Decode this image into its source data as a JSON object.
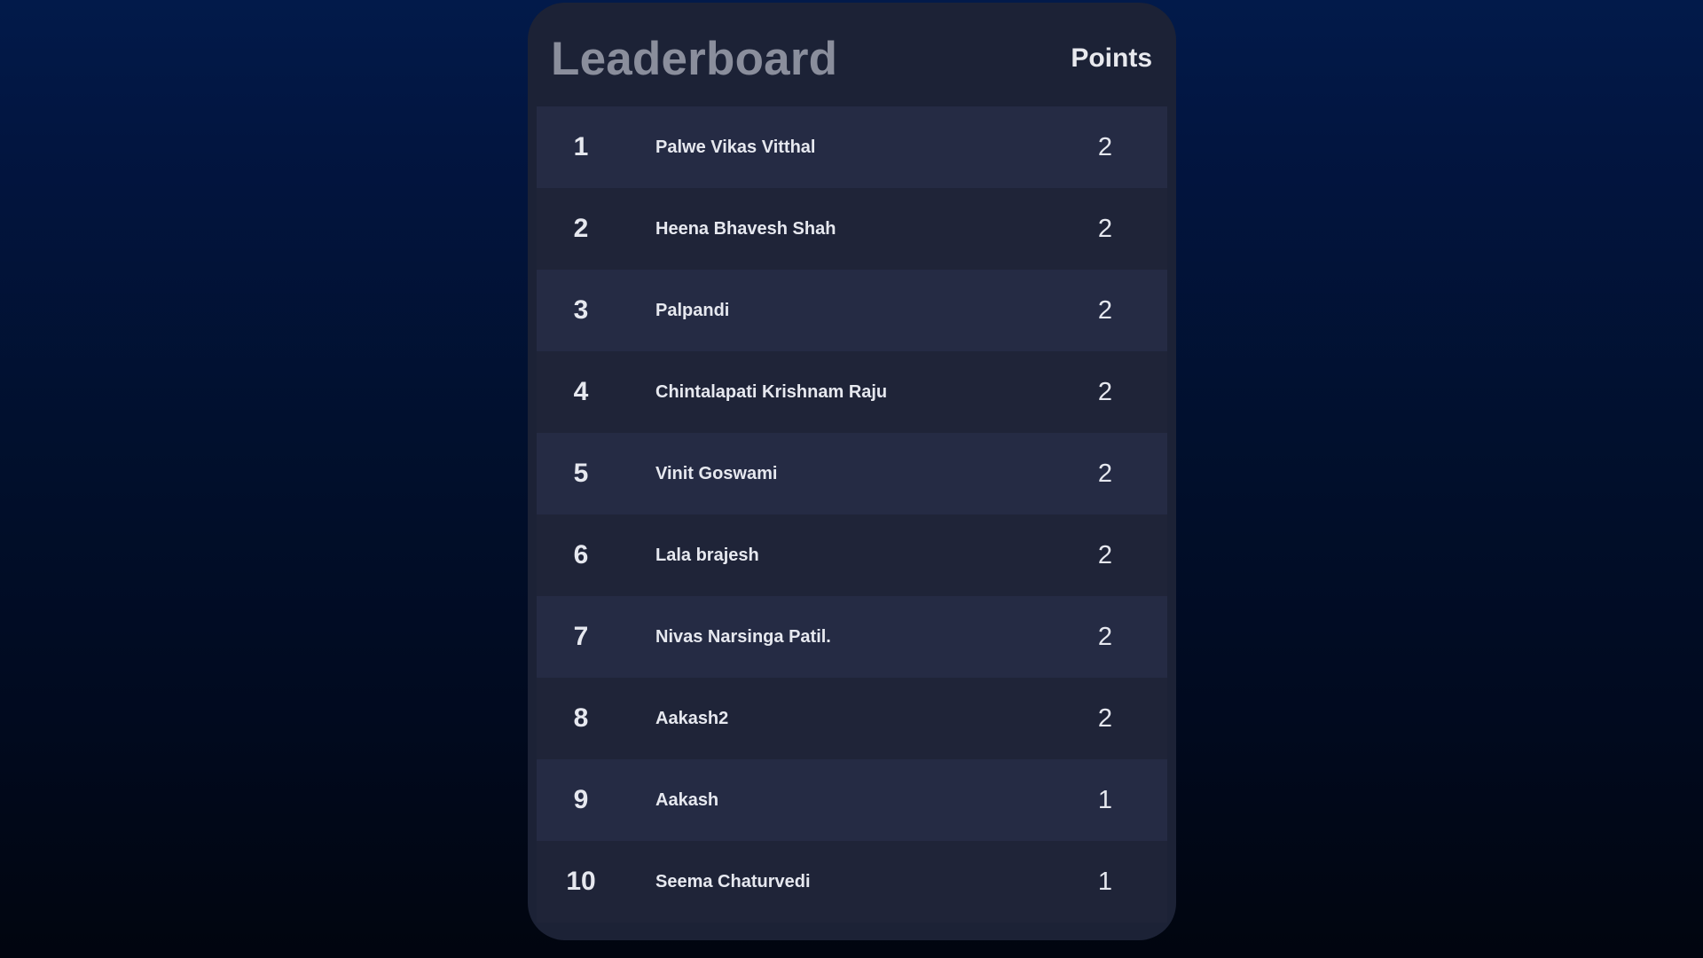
{
  "leaderboard": {
    "title": "Leaderboard",
    "points_header": "Points",
    "entries": [
      {
        "rank": "1",
        "name": "Palwe Vikas Vitthal",
        "points": "2"
      },
      {
        "rank": "2",
        "name": "Heena Bhavesh Shah",
        "points": "2"
      },
      {
        "rank": "3",
        "name": "Palpandi",
        "points": "2"
      },
      {
        "rank": "4",
        "name": "Chintalapati Krishnam Raju",
        "points": "2"
      },
      {
        "rank": "5",
        "name": "Vinit Goswami",
        "points": "2"
      },
      {
        "rank": "6",
        "name": "Lala brajesh",
        "points": "2"
      },
      {
        "rank": "7",
        "name": "Nivas Narsinga Patil.",
        "points": "2"
      },
      {
        "rank": "8",
        "name": "Aakash2",
        "points": "2"
      },
      {
        "rank": "9",
        "name": "Aakash",
        "points": "1"
      },
      {
        "rank": "10",
        "name": "Seema Chaturvedi",
        "points": "1"
      }
    ]
  },
  "colors": {
    "background_top": "#021a4a",
    "background_bottom": "#01050f",
    "card": "#1c2236",
    "row_odd": "#252b44",
    "row_even": "#1f2438",
    "title_text": "#8a8e9c",
    "text": "#e6e8ef"
  }
}
